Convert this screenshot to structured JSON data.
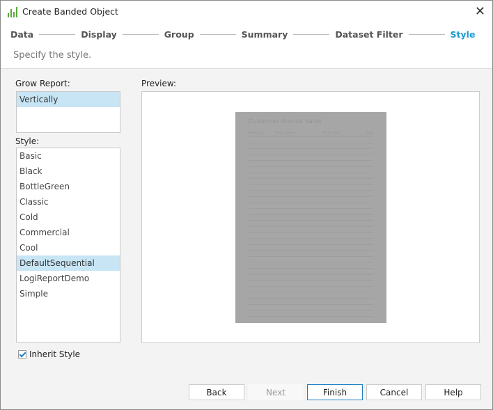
{
  "window": {
    "title": "Create Banded Object",
    "icon": "banded-object-icon",
    "close_icon": "close-icon"
  },
  "steps": [
    {
      "label": "Data"
    },
    {
      "label": "Display"
    },
    {
      "label": "Group"
    },
    {
      "label": "Summary"
    },
    {
      "label": "Dataset Filter"
    },
    {
      "label": "Style",
      "active": true
    }
  ],
  "subtitle": "Specify the style.",
  "grow_report": {
    "label": "Grow Report:",
    "items": [
      "Vertically"
    ],
    "selected": "Vertically"
  },
  "style": {
    "label": "Style:",
    "items": [
      "Basic",
      "Black",
      "BottleGreen",
      "Classic",
      "Cold",
      "Commercial",
      "Cool",
      "DefaultSequential",
      "LogiReportDemo",
      "Simple"
    ],
    "selected": "DefaultSequential"
  },
  "inherit_style": {
    "label": "Inherit Style",
    "checked": true
  },
  "preview": {
    "label": "Preview:",
    "report_title": "Customer Annual Sales",
    "columns": [
      "Product ID",
      "Product Name",
      "Product Type",
      "Total"
    ]
  },
  "buttons": {
    "back": "Back",
    "next": "Next",
    "finish": "Finish",
    "cancel": "Cancel",
    "help": "Help"
  },
  "colors": {
    "accent": "#1b9ad6",
    "selection": "#c7e5f5"
  }
}
